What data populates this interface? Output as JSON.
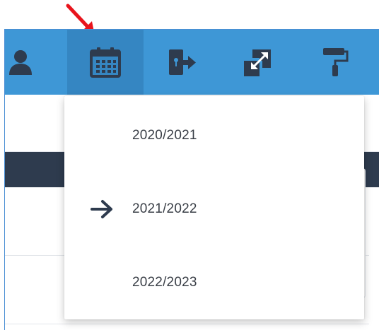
{
  "colors": {
    "accent": "#3e97d6",
    "accent_dark": "#3586c2",
    "navy": "#2e3b4e",
    "annotation_arrow": "#e8141c"
  },
  "toolbar": {
    "items": [
      {
        "icon": "user-icon"
      },
      {
        "icon": "calendar-icon",
        "active": true
      },
      {
        "icon": "door-exit-icon"
      },
      {
        "icon": "resize-expand-icon"
      },
      {
        "icon": "paint-roller-icon"
      }
    ]
  },
  "year_menu": {
    "options": [
      {
        "label": "2020/2021",
        "selected": false
      },
      {
        "label": "2021/2022",
        "selected": true
      },
      {
        "label": "2022/2023",
        "selected": false
      }
    ]
  }
}
